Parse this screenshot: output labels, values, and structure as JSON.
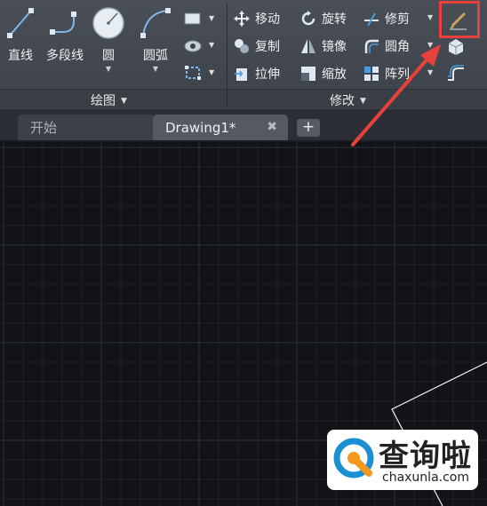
{
  "ribbon": {
    "draw_panel": {
      "title": "绘图",
      "tools": {
        "line": "直线",
        "polyline": "多段线",
        "circle": "圆",
        "arc": "圆弧"
      }
    },
    "modify_panel": {
      "title": "修改",
      "tools": {
        "move": "移动",
        "rotate": "旋转",
        "trim": "修剪",
        "copy": "复制",
        "mirror": "镜像",
        "fillet": "圆角",
        "stretch": "拉伸",
        "scale": "缩放",
        "array": "阵列"
      }
    }
  },
  "tabs": [
    {
      "label": "开始"
    },
    {
      "label": "Drawing1*"
    }
  ],
  "watermark": {
    "cn": "查询啦",
    "en": "chaxunla.com"
  },
  "colors": {
    "annotation_red": "#e8413b",
    "ribbon_bg": "#454a52",
    "canvas_bg": "#111317",
    "icon_blue": "#4a9ee0"
  }
}
